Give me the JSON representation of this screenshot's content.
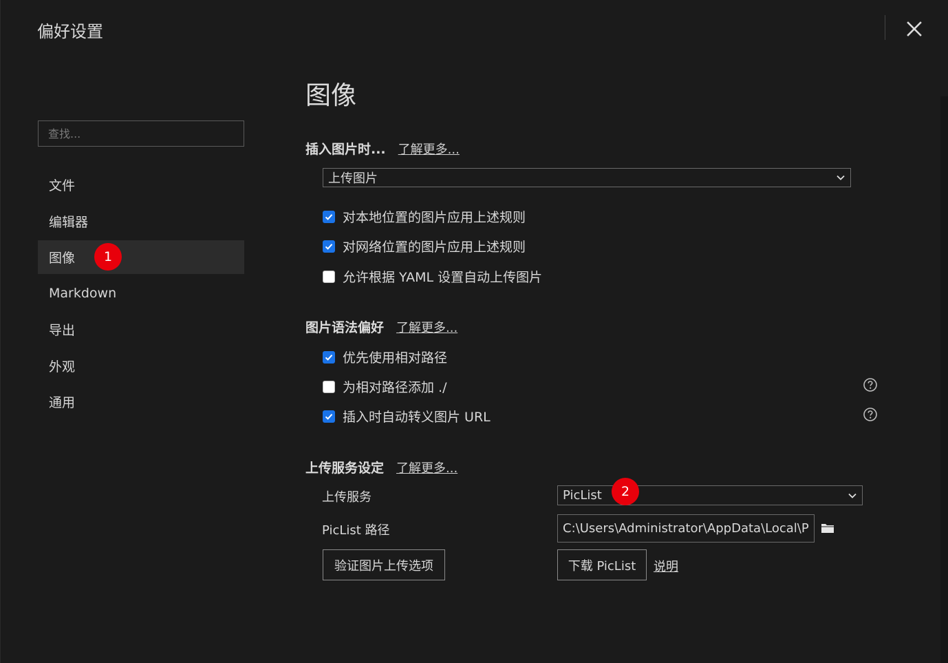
{
  "window": {
    "title": "偏好设置"
  },
  "search": {
    "placeholder": "查找..."
  },
  "sidebar": {
    "items": [
      {
        "label": "文件"
      },
      {
        "label": "编辑器"
      },
      {
        "label": "图像"
      },
      {
        "label": "Markdown"
      },
      {
        "label": "导出"
      },
      {
        "label": "外观"
      },
      {
        "label": "通用"
      }
    ],
    "active_index": 2,
    "badge": "1"
  },
  "main": {
    "title": "图像",
    "insert": {
      "heading": "插入图片时...",
      "link": "了解更多...",
      "select_value": "上传图片",
      "options": [
        {
          "label": "对本地位置的图片应用上述规则",
          "checked": true
        },
        {
          "label": "对网络位置的图片应用上述规则",
          "checked": true
        },
        {
          "label": "允许根据 YAML 设置自动上传图片",
          "checked": false
        }
      ]
    },
    "syntax": {
      "heading": "图片语法偏好",
      "link": "了解更多...",
      "options": [
        {
          "label": "优先使用相对路径",
          "checked": true
        },
        {
          "label": "为相对路径添加 ./",
          "checked": false
        },
        {
          "label": "插入时自动转义图片 URL",
          "checked": true
        }
      ]
    },
    "upload": {
      "heading": "上传服务设定",
      "link": "了解更多...",
      "service_label": "上传服务",
      "service_value": "PicList",
      "service_badge": "2",
      "path_label": "PicList 路径",
      "path_value": "C:\\Users\\Administrator\\AppData\\Local\\Programs\\PicList\\PicList.exe",
      "verify_button": "验证图片上传选项",
      "download_button": "下载 PicList",
      "doc_link": "说明"
    }
  },
  "colors": {
    "accent": "#1a73e8",
    "badge": "#e8000b",
    "background": "#1b1b1b"
  }
}
